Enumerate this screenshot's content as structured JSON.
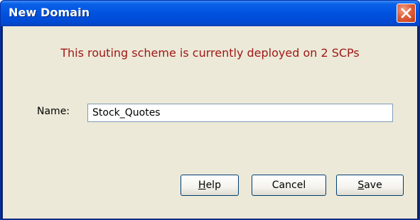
{
  "window": {
    "title": "New Domain"
  },
  "message": "This routing scheme is currently deployed on 2 SCPs",
  "form": {
    "name_label": "Name:",
    "name_value": "Stock_Quotes"
  },
  "buttons": {
    "help": {
      "mnemonic": "H",
      "rest": "elp"
    },
    "cancel": "Cancel",
    "save": {
      "mnemonic": "S",
      "rest": "ave"
    }
  },
  "icons": {
    "close": "close-icon"
  },
  "colors": {
    "title_bar": "#0052df",
    "message_text": "#a01818",
    "dialog_background": "#ece9d8",
    "close_button": "#e0603c"
  }
}
